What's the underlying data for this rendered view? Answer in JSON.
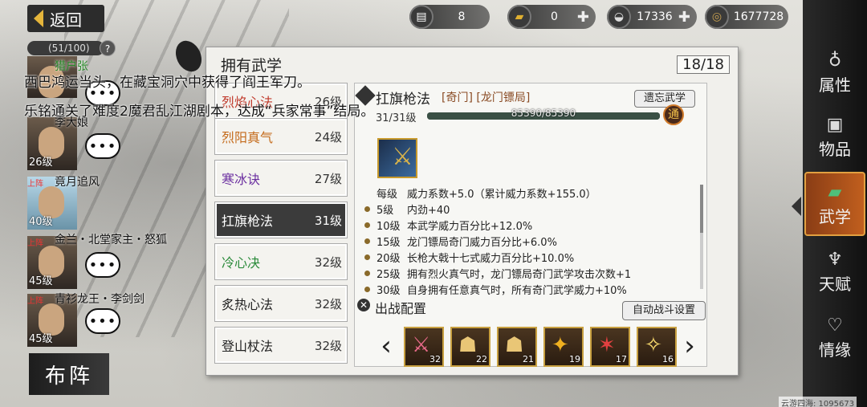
{
  "header": {
    "back_label": "返回",
    "resources": [
      {
        "icon": "ticket-icon",
        "value": "8",
        "plus": false
      },
      {
        "icon": "gold-bar-icon",
        "value": "0",
        "plus": true
      },
      {
        "icon": "silver-ingot-icon",
        "value": "17336",
        "plus": true
      },
      {
        "icon": "coin-icon",
        "value": "1677728",
        "plus": false
      }
    ]
  },
  "team": {
    "capacity": "(51/100)",
    "help": "?",
    "members": [
      {
        "name": "猎户张",
        "level": "",
        "up": ""
      },
      {
        "name": "李大娘",
        "level": "26级",
        "up": ""
      },
      {
        "name": "竟月追风",
        "level": "40级",
        "up": "上阵"
      },
      {
        "name": "金兰・北堂家主・怒狐",
        "level": "45级",
        "up": "上阵"
      },
      {
        "name": "青衫龙王・李剑剑",
        "level": "45级",
        "up": "上阵"
      }
    ],
    "bubble": "•••",
    "formation_button": "布阵"
  },
  "log": [
    "西巴鸿运当头，在藏宝洞穴中获得了阎王军刀。",
    "乐铭通关了难度2魔君乱江湖剧本，达成“兵家常事”结局。"
  ],
  "panel": {
    "title": "拥有武学",
    "count": "18/18",
    "skills": [
      {
        "name": "烈焰心法",
        "level": "26级",
        "color": "#c0392b",
        "active": false
      },
      {
        "name": "烈阳真气",
        "level": "24级",
        "color": "#c46a1a",
        "active": false
      },
      {
        "name": "寒冰诀",
        "level": "27级",
        "color": "#6b2fa0",
        "active": false
      },
      {
        "name": "扛旗枪法",
        "level": "31级",
        "color": "#ffffff",
        "active": true
      },
      {
        "name": "冷心决",
        "level": "32级",
        "color": "#2a8a3a",
        "active": false
      },
      {
        "name": "炙热心法",
        "level": "32级",
        "color": "#333333",
        "active": false
      },
      {
        "name": "登山杖法",
        "level": "32级",
        "color": "#333333",
        "active": false
      }
    ],
    "detail": {
      "name": "扛旗枪法",
      "tags": "[奇门] [龙门镖局]",
      "forget_button": "遗忘武学",
      "progress_label": "31/31级",
      "exp_text": "85390/85390",
      "exp_fraction": 1.0,
      "tong_badge": "通",
      "base_effect": {
        "level": "每级",
        "text": "威力系数+5.0（累计威力系数+155.0）"
      },
      "effects": [
        {
          "level": "5级",
          "text": "内劲+40"
        },
        {
          "level": "10级",
          "text": "本武学威力百分比+12.0%"
        },
        {
          "level": "15级",
          "text": "龙门镖局奇门威力百分比+6.0%"
        },
        {
          "level": "20级",
          "text": "长枪大戟十七式威力百分比+10.0%"
        },
        {
          "level": "25级",
          "text": "拥有烈火真气时，龙门镖局奇门武学攻击次数+1"
        },
        {
          "level": "30级",
          "text": "自身拥有任意真气时，所有奇门武学威力+10%"
        }
      ]
    },
    "deploy": {
      "title": "出战配置",
      "auto_button": "自动战斗设置",
      "slots": [
        {
          "icon": "sword-strike-icon",
          "count": "32"
        },
        {
          "icon": "meditate-icon",
          "count": "22"
        },
        {
          "icon": "meditate-icon",
          "count": "21"
        },
        {
          "icon": "kick-icon",
          "count": "19"
        },
        {
          "icon": "claw-icon",
          "count": "17"
        },
        {
          "icon": "flash-icon",
          "count": "16"
        }
      ]
    }
  },
  "tabs": [
    {
      "label": "属性",
      "icon": "gourd-icon",
      "active": false
    },
    {
      "label": "物品",
      "icon": "box-icon",
      "active": false
    },
    {
      "label": "武学",
      "icon": "book-icon",
      "active": true
    },
    {
      "label": "天赋",
      "icon": "branch-icon",
      "active": false
    },
    {
      "label": "情缘",
      "icon": "heart-icon",
      "active": false
    }
  ],
  "server": "云游四海: 1095673"
}
